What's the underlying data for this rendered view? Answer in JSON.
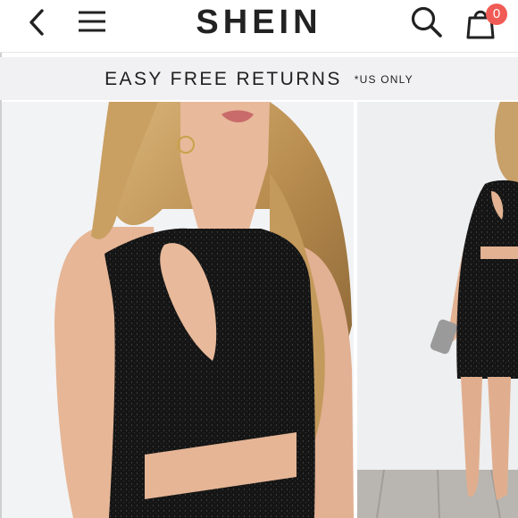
{
  "header": {
    "brand": "SHEIN",
    "cart_count": "0",
    "icons": {
      "back": "chevron-left-icon",
      "menu": "hamburger-menu-icon",
      "search": "search-icon",
      "cart": "shopping-bag-icon"
    }
  },
  "promo": {
    "text": "EASY FREE RETURNS",
    "note": "*US ONLY"
  },
  "gallery": {
    "images": [
      "product-closeup-photo",
      "product-full-body-photo"
    ]
  },
  "colors": {
    "badge": "#f15b55",
    "brand_text": "#222222",
    "promo_background": "#f1f0f2"
  }
}
